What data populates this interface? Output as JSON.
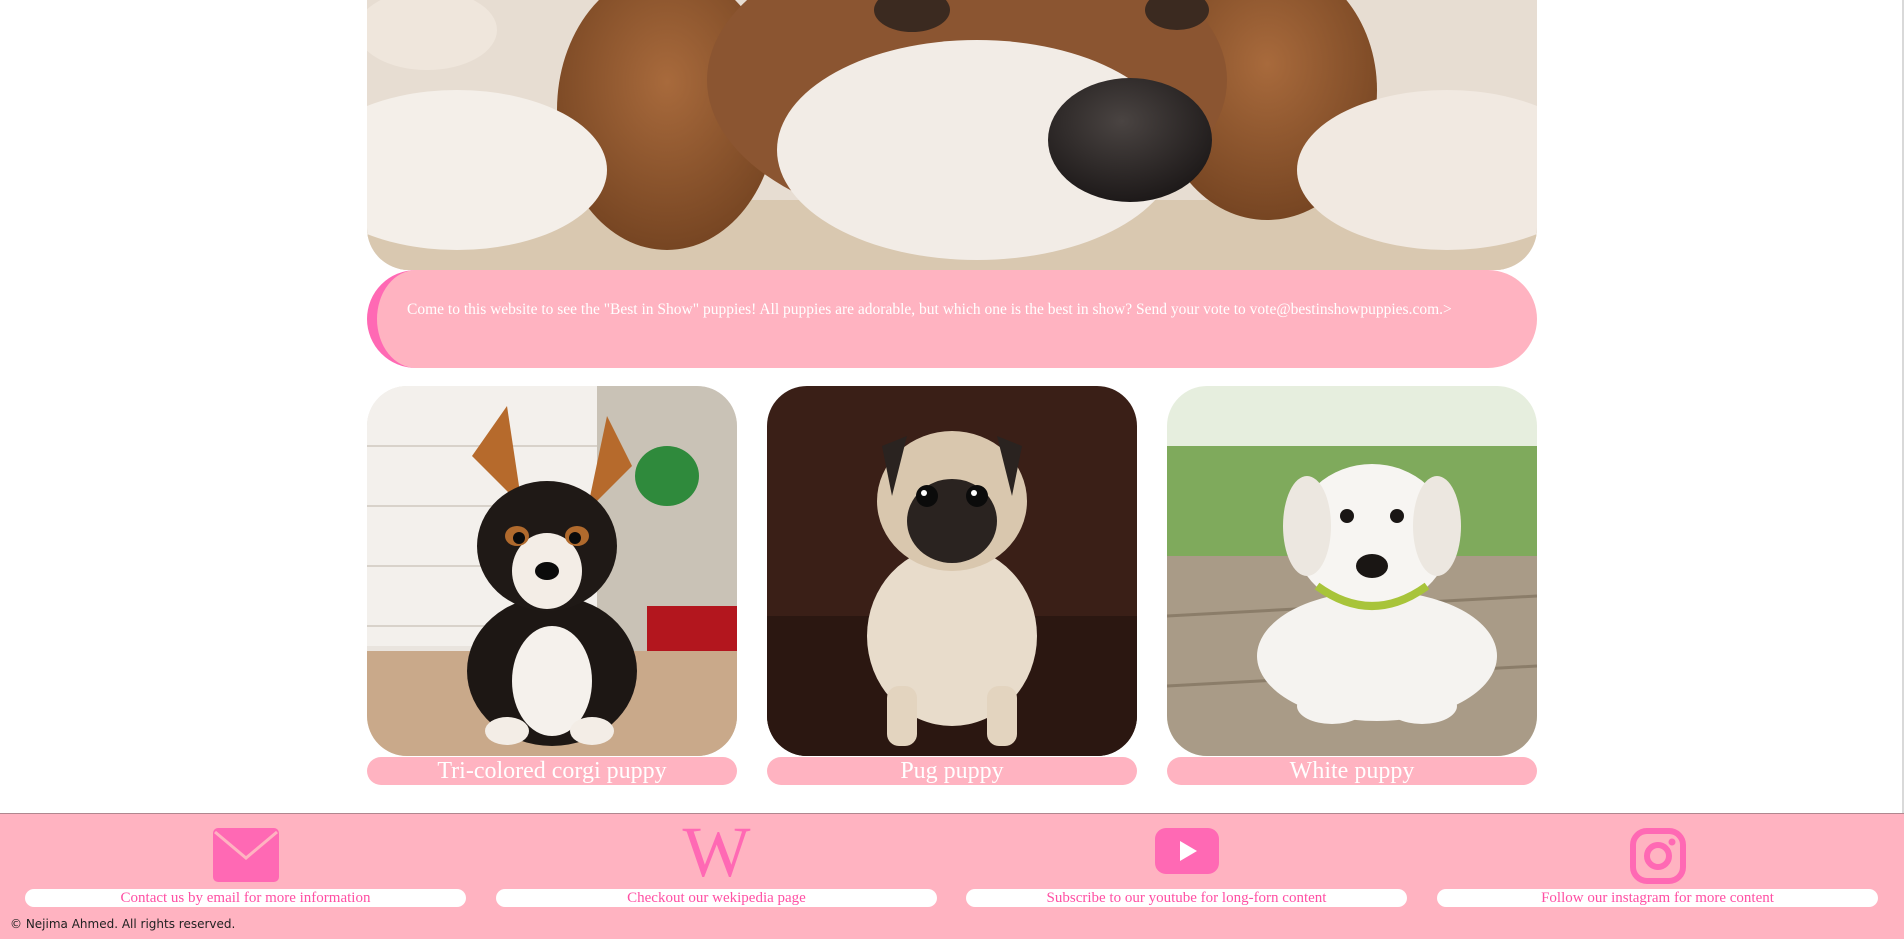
{
  "hero": {
    "alt": "Spaniel dog resting face close-up"
  },
  "intro": {
    "text": "Come to this website to see the \"Best in Show\" puppies! All puppies are adorable, but which one is the best in show? Send your vote to vote@bestinshowpuppies.com.>"
  },
  "gallery": [
    {
      "caption": "Tri-colored corgi puppy"
    },
    {
      "caption": "Pug puppy"
    },
    {
      "caption": "White puppy"
    }
  ],
  "footer": {
    "links": [
      {
        "label": "Contact us by email for more information",
        "icon": "envelope-icon"
      },
      {
        "label": "Checkout our wekipedia page",
        "icon": "wikipedia-icon"
      },
      {
        "label": "Subscribe to our youtube for long-forn content",
        "icon": "youtube-icon"
      },
      {
        "label": "Follow our instagram for more content",
        "icon": "instagram-icon"
      }
    ],
    "wiki_glyph": "W",
    "copyright": "© Nejima Ahmed. All rights reserved."
  },
  "colors": {
    "accent_pink": "#ffb3c1",
    "hot_pink": "#ff69b4",
    "link_pink": "#ff4fa3"
  }
}
